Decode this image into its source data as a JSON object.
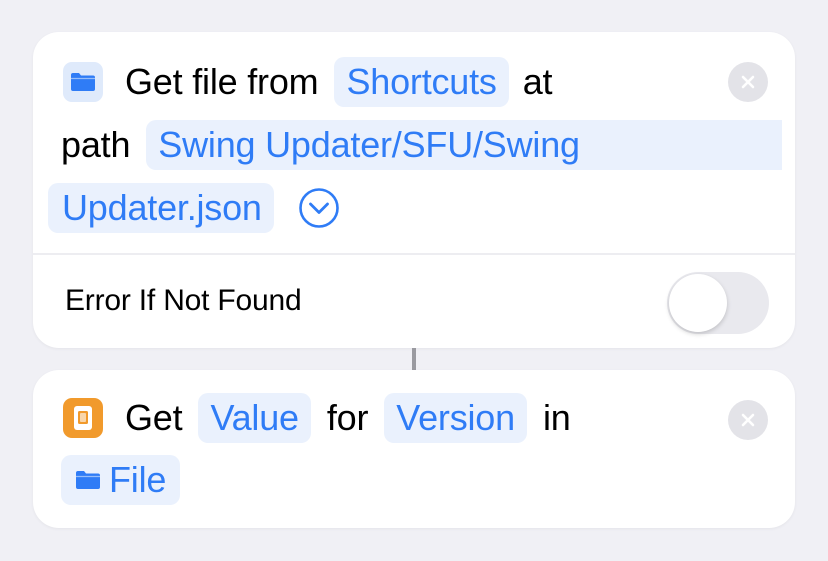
{
  "action1": {
    "verb": "Get file from",
    "location_token": "Shortcuts",
    "at_word": "at",
    "path_word": "path",
    "path_line1": "Swing Updater/SFU/Swing",
    "path_line2": "Updater.json",
    "option_label": "Error If Not Found",
    "option_enabled": false,
    "icon": "folder-icon"
  },
  "action2": {
    "verb": "Get",
    "value_token": "Value",
    "for_word": "for",
    "key_token": "Version",
    "in_word": "in",
    "input_token": "File",
    "icon": "dictionary-icon"
  },
  "colors": {
    "accent": "#2f7cf6",
    "token_bg": "#eaf1fd",
    "data_icon": "#f19a2c"
  }
}
